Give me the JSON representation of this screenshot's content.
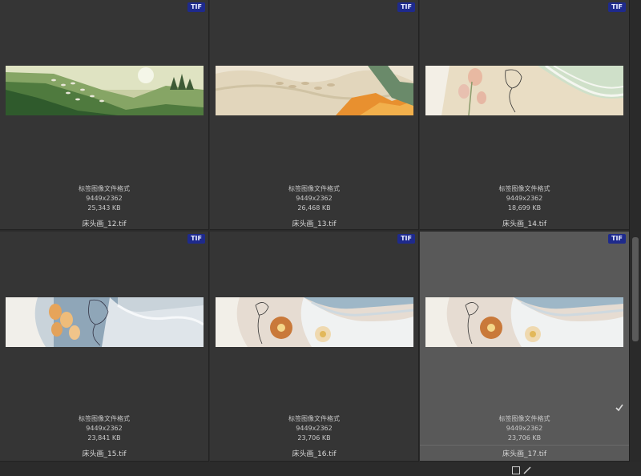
{
  "items": [
    {
      "badge": "TIF",
      "label": "标签图像文件格式",
      "dims": "9449x2362",
      "size": "25,343 KB",
      "name": "床头画_12.tif"
    },
    {
      "badge": "TIF",
      "label": "标签图像文件格式",
      "dims": "9449x2362",
      "size": "26,468 KB",
      "name": "床头画_13.tif"
    },
    {
      "badge": "TIF",
      "label": "标签图像文件格式",
      "dims": "9449x2362",
      "size": "18,699 KB",
      "name": "床头画_14.tif"
    },
    {
      "badge": "TIF",
      "label": "标签图像文件格式",
      "dims": "9449x2362",
      "size": "23,841 KB",
      "name": "床头画_15.tif"
    },
    {
      "badge": "TIF",
      "label": "标签图像文件格式",
      "dims": "9449x2362",
      "size": "23,706 KB",
      "name": "床头画_16.tif"
    },
    {
      "badge": "TIF",
      "label": "标签图像文件格式",
      "dims": "9449x2362",
      "size": "23,706 KB",
      "name": "床头画_17.tif",
      "selected": true
    }
  ],
  "icons": {
    "select_box": "square-outline-icon",
    "edit": "pencil-icon",
    "check": "checkmark-icon"
  },
  "colors": {
    "background": "#2b2b2b",
    "cell": "#353535",
    "selected_cell": "#595959",
    "badge": "#1e2a8c"
  }
}
